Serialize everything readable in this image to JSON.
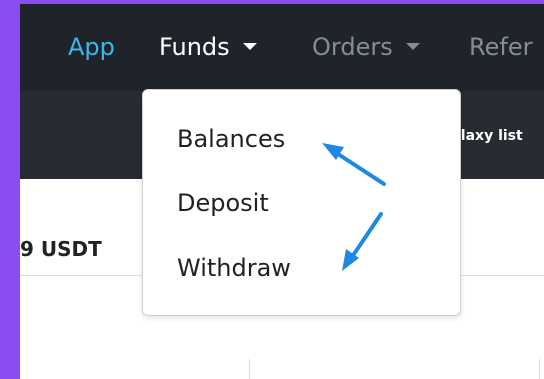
{
  "nav": {
    "app_label": "App",
    "funds_label": "Funds",
    "orders_label": "Orders",
    "refer_label": "Refer"
  },
  "subbar": {
    "ticker_text": "ilaxy list"
  },
  "content": {
    "balance_fragment": "9 USDT"
  },
  "dropdown": {
    "items": [
      {
        "label": "Balances"
      },
      {
        "label": "Deposit"
      },
      {
        "label": "Withdraw"
      }
    ]
  },
  "colors": {
    "frame": "#8b4cf2",
    "navbar": "#1f242b",
    "subbar": "#272c33",
    "accent_app": "#3fb6e8",
    "annotation_arrow": "#1e88e5"
  }
}
